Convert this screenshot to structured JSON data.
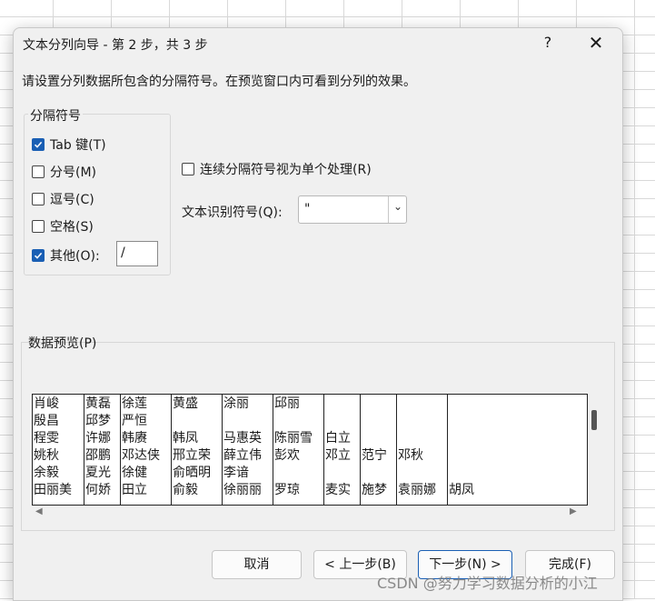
{
  "dialog": {
    "title": "文本分列向导 - 第 2 步，共 3 步",
    "help_label": "?",
    "close_label": "✕",
    "description": "请设置分列数据所包含的分隔符号。在预览窗口内可看到分列的效果。"
  },
  "delimiters": {
    "group_label": "分隔符号",
    "items": [
      {
        "label": "Tab 键(T)",
        "checked": true
      },
      {
        "label": "分号(M)",
        "checked": false
      },
      {
        "label": "逗号(C)",
        "checked": false
      },
      {
        "label": "空格(S)",
        "checked": false
      },
      {
        "label": "其他(O):",
        "checked": true
      }
    ],
    "other_value": "/"
  },
  "consecutive": {
    "label": "连续分隔符号视为单个处理(R)",
    "checked": false
  },
  "text_qualifier": {
    "label": "文本识别符号(Q):",
    "value": "\"",
    "icon": "chevron-down-icon"
  },
  "preview": {
    "label": "数据预览(P)",
    "columns": [
      [
        "肖峻",
        "殷昌",
        "程雯",
        "姚秋",
        "余毅",
        "田丽美"
      ],
      [
        "黄磊",
        "邱梦",
        "许娜",
        "邵鹏",
        "夏光",
        "何娇"
      ],
      [
        "徐莲",
        "严恒",
        "韩赓",
        "邓达侠",
        "徐健",
        "田立"
      ],
      [
        "黄盛",
        "",
        "韩凤",
        "邢立荣",
        "俞晒明",
        "俞毅"
      ],
      [
        "涂丽",
        "",
        "马惠英",
        "薛立伟",
        "李谙",
        "徐丽丽"
      ],
      [
        "邱丽",
        "",
        "陈丽雪",
        "彭欢",
        "",
        "罗琼"
      ],
      [
        "",
        "",
        "白立",
        "邓立",
        "",
        "麦实"
      ],
      [
        "",
        "",
        "",
        "范宁",
        "",
        "施梦"
      ],
      [
        "",
        "",
        "",
        "邓秋",
        "",
        "袁丽娜"
      ],
      [
        "",
        "",
        "",
        "",
        "",
        "胡凤"
      ]
    ]
  },
  "buttons": {
    "cancel": "取消",
    "back": "< 上一步(B)",
    "next": "下一步(N) >",
    "finish": "完成(F)"
  },
  "watermark": "CSDN @努力学习数据分析的小江",
  "colors": {
    "accent": "#1a5fb4",
    "dialog_bg": "#f0f0f0"
  }
}
